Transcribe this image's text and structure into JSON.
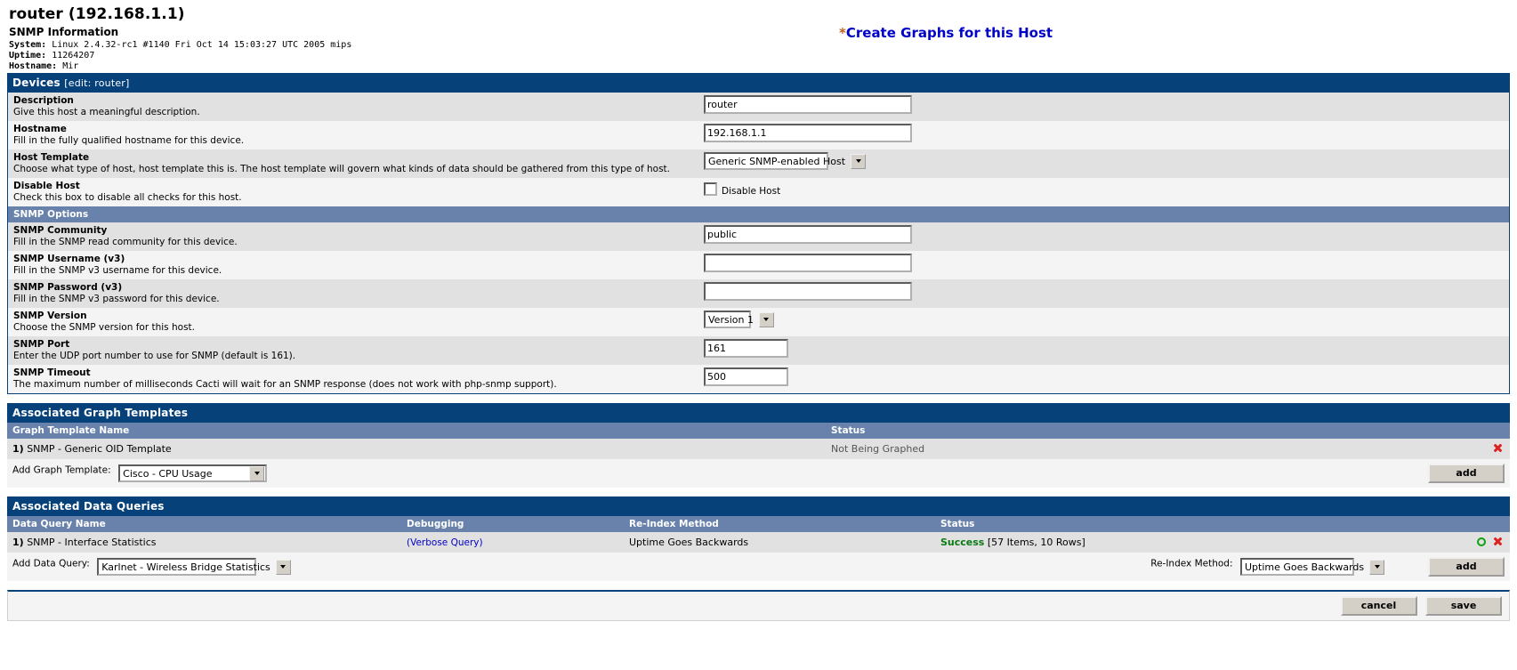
{
  "header": {
    "host_title": "router (192.168.1.1)",
    "snmp_heading": "SNMP Information",
    "system_label": "System:",
    "system_value": "Linux 2.4.32-rc1 #1140 Fri Oct 14 15:03:27 UTC 2005 mips",
    "uptime_label": "Uptime:",
    "uptime_value": "11264207",
    "hostname_label": "Hostname:",
    "hostname_value": "Mir",
    "create_graphs_asterisk": "*",
    "create_graphs_link": "Create Graphs for this Host"
  },
  "devices": {
    "bar_title": "Devices",
    "bar_subtitle": "[edit: router]",
    "snmp_options_label": "SNMP Options",
    "fields": [
      {
        "name": "Description",
        "desc": "Give this host a meaningful description.",
        "value": "router"
      },
      {
        "name": "Hostname",
        "desc": "Fill in the fully qualified hostname for this device.",
        "value": "192.168.1.1"
      },
      {
        "name": "Host Template",
        "desc": "Choose what type of host, host template this is. The host template will govern what kinds of data should be gathered from this type of host.",
        "value": "Generic SNMP-enabled Host"
      },
      {
        "name": "Disable Host",
        "desc": "Check this box to disable all checks for this host.",
        "checkbox_label": "Disable Host",
        "checked": false
      },
      {
        "name": "SNMP Community",
        "desc": "Fill in the SNMP read community for this device.",
        "value": "public"
      },
      {
        "name": "SNMP Username (v3)",
        "desc": "Fill in the SNMP v3 username for this device.",
        "value": ""
      },
      {
        "name": "SNMP Password (v3)",
        "desc": "Fill in the SNMP v3 password for this device.",
        "value": ""
      },
      {
        "name": "SNMP Version",
        "desc": "Choose the SNMP version for this host.",
        "value": "Version 1"
      },
      {
        "name": "SNMP Port",
        "desc": "Enter the UDP port number to use for SNMP (default is 161).",
        "value": "161"
      },
      {
        "name": "SNMP Timeout",
        "desc": "The maximum number of milliseconds Cacti will wait for an SNMP response (does not work with php-snmp support).",
        "value": "500"
      }
    ]
  },
  "graph_templates": {
    "bar_title": "Associated Graph Templates",
    "col_name": "Graph Template Name",
    "col_status": "Status",
    "rows": [
      {
        "index": "1)",
        "name": "SNMP - Generic OID Template",
        "status": "Not Being Graphed"
      }
    ],
    "add_label": "Add Graph Template:",
    "add_value": "Cisco - CPU Usage",
    "add_button": "add"
  },
  "data_queries": {
    "bar_title": "Associated Data Queries",
    "col_name": "Data Query Name",
    "col_debugging": "Debugging",
    "col_reindex": "Re-Index Method",
    "col_status": "Status",
    "rows": [
      {
        "index": "1)",
        "name": "SNMP - Interface Statistics",
        "debug_link": "(Verbose Query)",
        "reindex": "Uptime Goes Backwards",
        "status_word": "Success",
        "status_detail": "[57 Items, 10 Rows]"
      }
    ],
    "add_label": "Add Data Query:",
    "add_value": "Karlnet - Wireless Bridge Statistics",
    "reindex_label": "Re-Index Method:",
    "reindex_value": "Uptime Goes Backwards",
    "add_button": "add"
  },
  "footer": {
    "cancel_label": "cancel",
    "save_label": "save"
  },
  "colors": {
    "bar_blue": "#064179",
    "subbar_blue": "#6882ab",
    "link_blue": "#0000c8",
    "success_green": "#0a7a12",
    "delete_red": "#e02020"
  }
}
